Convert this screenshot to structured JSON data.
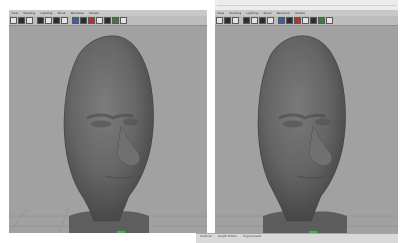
{
  "left_viewport": {
    "menu": [
      "View",
      "Shading",
      "Lighting",
      "Show",
      "Renderer",
      "Panels"
    ]
  },
  "right_viewport": {
    "menu": [
      "View",
      "Shading",
      "Lighting",
      "Show",
      "Renderer",
      "Panels"
    ]
  },
  "icons": {
    "toolbar": [
      "select-camera-icon",
      "camera-attributes-icon",
      "bookmark-icon",
      "image-plane-icon",
      "grid-icon",
      "film-gate-icon",
      "resolution-gate-icon",
      "wireframe-icon",
      "smooth-shade-icon",
      "textured-icon",
      "lights-icon",
      "shadows-icon",
      "isolate-icon",
      "xray-icon"
    ]
  },
  "status_bar": {
    "items": [
      "Outliner",
      "Graph Editor",
      "Hypershade"
    ]
  },
  "colors": {
    "viewport_bg": "#a1a1a1",
    "model": "#6a6a6a",
    "toolbar": "#bdbdbd"
  }
}
